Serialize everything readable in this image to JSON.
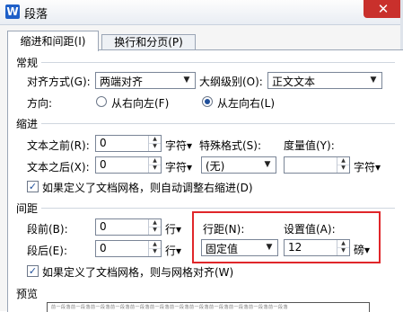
{
  "window": {
    "title": "段落",
    "logo": "W",
    "close": "✕"
  },
  "tabs": [
    {
      "label": "缩进和间距(I)",
      "active": true
    },
    {
      "label": "换行和分页(P)",
      "active": false
    }
  ],
  "general": {
    "section": "常规",
    "alignment_label": "对齐方式(G):",
    "alignment_value": "两端对齐",
    "outline_label": "大纲级别(O):",
    "outline_value": "正文文本",
    "direction_label": "方向:",
    "rtl_label": "从右向左(F)",
    "ltr_label": "从左向右(L)",
    "direction_selected": "ltr"
  },
  "indent": {
    "section": "缩进",
    "before_label": "文本之前(R):",
    "before_value": "0",
    "before_unit": "字符▾",
    "after_label": "文本之后(X):",
    "after_value": "0",
    "after_unit": "字符▾",
    "special_label": "特殊格式(S):",
    "special_value": "(无)",
    "by_label": "度量值(Y):",
    "by_value": "",
    "by_unit": "字符▾",
    "grid_checkbox": "如果定义了文档网格，则自动调整右缩进(D)",
    "grid_checked": true
  },
  "spacing": {
    "section": "间距",
    "before_label": "段前(B):",
    "before_value": "0",
    "before_unit": "行▾",
    "after_label": "段后(E):",
    "after_value": "0",
    "after_unit": "行▾",
    "line_label": "行距(N):",
    "line_value": "固定值",
    "at_label": "设置值(A):",
    "at_value": "12",
    "at_unit": "磅▾",
    "grid_checkbox": "如果定义了文档网格，则与网格对齐(W)",
    "grid_checked": true
  },
  "preview": {
    "section": "预览",
    "sample": "前一段落前一段落前一段落前一段落前一段落前一段落前一段落前一段落前一段落前一段落前一段落前一段落"
  },
  "colors": {
    "highlight": "#e0262a",
    "accent": "#1e5fc8"
  }
}
